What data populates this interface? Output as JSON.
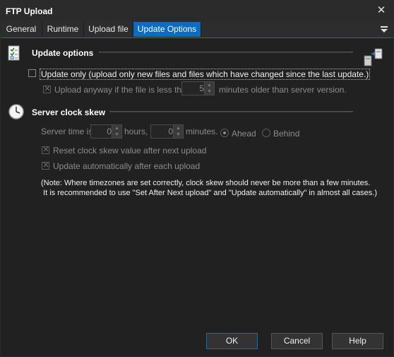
{
  "window": {
    "title": "FTP Upload"
  },
  "tabs": [
    "General",
    "Runtime",
    "Upload file",
    "Update Options"
  ],
  "update_options": {
    "header": "Update options",
    "update_only_label": "Update only (upload only new files and files which have changed since the last update.)",
    "upload_anyway_label": "Upload anyway if the file is less than",
    "minutes_value": "5",
    "minutes_suffix": "minutes older than server version."
  },
  "clock_skew": {
    "header": "Server clock skew",
    "server_time_label": "Server time is",
    "hours_value": "0",
    "hours_label": "hours,",
    "minutes_value": "0",
    "minutes_label": "minutes.",
    "ahead_label": "Ahead",
    "behind_label": "Behind",
    "reset_label": "Reset clock skew value after  next upload",
    "update_auto_label": "Update automatically after each upload",
    "note_line1": "(Note: Where timezones are set correctly, clock skew should never be more than a few minutes.",
    "note_line2": " It is recommended to use \"Set After Next upload\" and \"Update automatically\" in almost all cases.)"
  },
  "buttons": {
    "ok": "OK",
    "cancel": "Cancel",
    "help": "Help"
  },
  "icons": [
    "checklist-icon",
    "server-transfer-icon",
    "clock-icon",
    "close-icon",
    "menu-icon"
  ]
}
